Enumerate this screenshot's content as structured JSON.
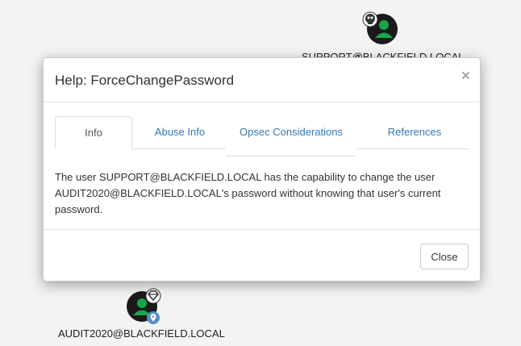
{
  "graph": {
    "nodes": {
      "support_label": "SUPPORT@BLACKFIELD.LOCAL",
      "audit_label": "AUDIT2020@BLACKFIELD.LOCAL"
    }
  },
  "modal": {
    "title": "Help: ForceChangePassword",
    "close_symbol": "×",
    "tabs": [
      {
        "label": "Info"
      },
      {
        "label": "Abuse Info"
      },
      {
        "label": "Opsec Considerations"
      },
      {
        "label": "References"
      }
    ],
    "active_tab": "Info",
    "content": "The user SUPPORT@BLACKFIELD.LOCAL has the capability to change the user AUDIT2020@BLACKFIELD.LOCAL's password without knowing that user's current password.",
    "close_button_label": "Close"
  },
  "colors": {
    "user_node": "#17a74a",
    "link": "#337ab7"
  }
}
